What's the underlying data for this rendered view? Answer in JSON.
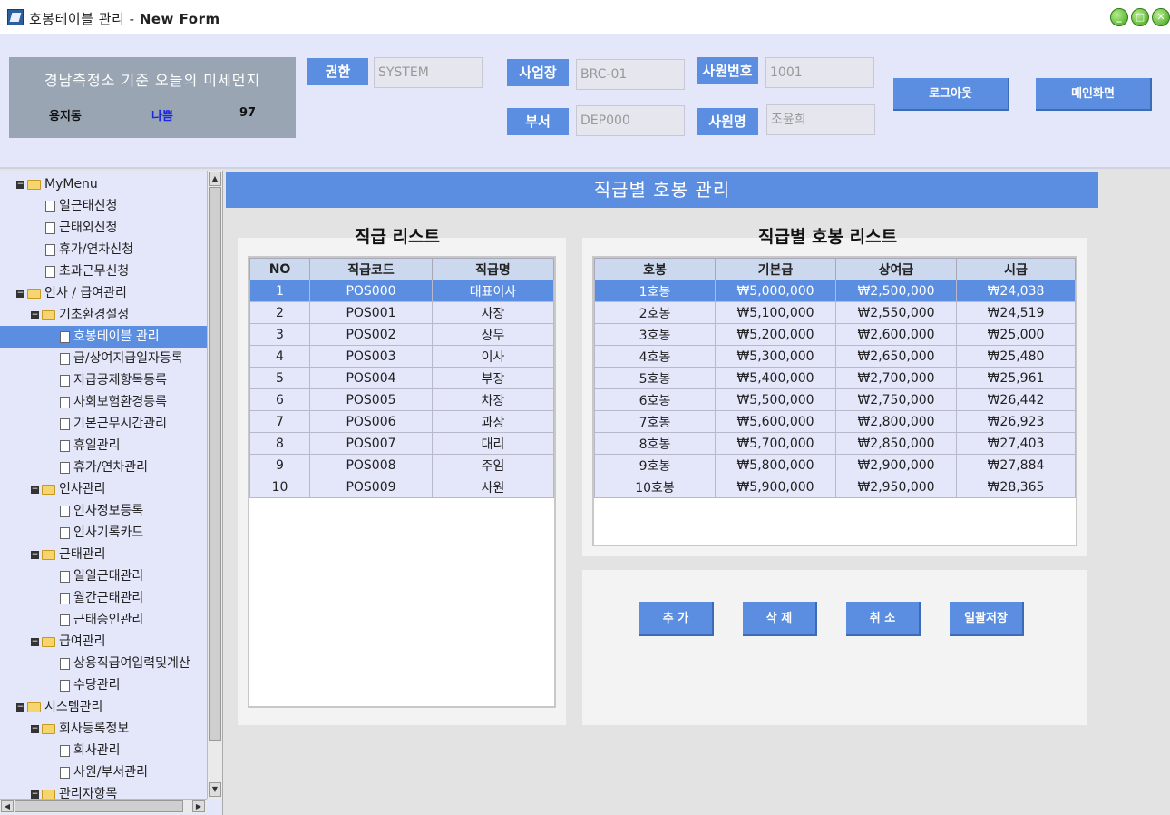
{
  "window": {
    "title_prefix": "호봉테이블 관리 - ",
    "title_bold": "New Form",
    "buttons": [
      "_",
      "□",
      "✕"
    ]
  },
  "dust": {
    "title": "경남측정소 기준 오늘의 미세먼지",
    "location": "용지동",
    "status": "나쁨",
    "value": "97"
  },
  "header": {
    "auth_label": "권한",
    "auth_value": "SYSTEM",
    "site_label": "사업장",
    "site_value": "BRC-01",
    "emp_no_label": "사원번호",
    "emp_no_value": "1001",
    "dept_label": "부서",
    "dept_value": "DEP000",
    "emp_name_label": "사원명",
    "emp_name_value": "조윤희",
    "logout_label": "로그아웃",
    "main_label": "메인화면"
  },
  "tree": [
    {
      "label": "MyMenu",
      "type": "folder"
    },
    {
      "label": "일근태신청",
      "type": "doc"
    },
    {
      "label": "근태외신청",
      "type": "doc"
    },
    {
      "label": "휴가/연차신청",
      "type": "doc"
    },
    {
      "label": "초과근무신청",
      "type": "doc"
    },
    {
      "label": "인사 / 급여관리",
      "type": "folder"
    },
    {
      "label": "기초환경설정",
      "type": "folder"
    },
    {
      "label": "호봉테이블 관리",
      "type": "doc",
      "selected": true
    },
    {
      "label": "급/상여지급일자등록",
      "type": "doc"
    },
    {
      "label": "지급공제항목등록",
      "type": "doc"
    },
    {
      "label": "사회보험환경등록",
      "type": "doc"
    },
    {
      "label": "기본근무시간관리",
      "type": "doc"
    },
    {
      "label": "휴일관리",
      "type": "doc"
    },
    {
      "label": "휴가/연차관리",
      "type": "doc"
    },
    {
      "label": "인사관리",
      "type": "folder"
    },
    {
      "label": "인사정보등록",
      "type": "doc"
    },
    {
      "label": "인사기록카드",
      "type": "doc"
    },
    {
      "label": "근태관리",
      "type": "folder"
    },
    {
      "label": "일일근태관리",
      "type": "doc"
    },
    {
      "label": "월간근태관리",
      "type": "doc"
    },
    {
      "label": "근태승인관리",
      "type": "doc"
    },
    {
      "label": "급여관리",
      "type": "folder"
    },
    {
      "label": "상용직급여입력및계산",
      "type": "doc"
    },
    {
      "label": "수당관리",
      "type": "doc"
    },
    {
      "label": "시스템관리",
      "type": "folder"
    },
    {
      "label": "회사등록정보",
      "type": "folder"
    },
    {
      "label": "회사관리",
      "type": "doc"
    },
    {
      "label": "사원/부서관리",
      "type": "doc"
    },
    {
      "label": "관리자항목",
      "type": "folder"
    }
  ],
  "main": {
    "banner": "직급별 호봉 관리",
    "left_title": "직급 리스트",
    "right_title": "직급별 호봉 리스트",
    "left_headers": [
      "NO",
      "직급코드",
      "직급명"
    ],
    "left_rows": [
      [
        "1",
        "POS000",
        "대표이사"
      ],
      [
        "2",
        "POS001",
        "사장"
      ],
      [
        "3",
        "POS002",
        "상무"
      ],
      [
        "4",
        "POS003",
        "이사"
      ],
      [
        "5",
        "POS004",
        "부장"
      ],
      [
        "6",
        "POS005",
        "차장"
      ],
      [
        "7",
        "POS006",
        "과장"
      ],
      [
        "8",
        "POS007",
        "대리"
      ],
      [
        "9",
        "POS008",
        "주임"
      ],
      [
        "10",
        "POS009",
        "사원"
      ]
    ],
    "right_headers": [
      "호봉",
      "기본급",
      "상여급",
      "시급"
    ],
    "right_rows": [
      [
        "1호봉",
        "₩5,000,000",
        "₩2,500,000",
        "₩24,038"
      ],
      [
        "2호봉",
        "₩5,100,000",
        "₩2,550,000",
        "₩24,519"
      ],
      [
        "3호봉",
        "₩5,200,000",
        "₩2,600,000",
        "₩25,000"
      ],
      [
        "4호봉",
        "₩5,300,000",
        "₩2,650,000",
        "₩25,480"
      ],
      [
        "5호봉",
        "₩5,400,000",
        "₩2,700,000",
        "₩25,961"
      ],
      [
        "6호봉",
        "₩5,500,000",
        "₩2,750,000",
        "₩26,442"
      ],
      [
        "7호봉",
        "₩5,600,000",
        "₩2,800,000",
        "₩26,923"
      ],
      [
        "8호봉",
        "₩5,700,000",
        "₩2,850,000",
        "₩27,403"
      ],
      [
        "9호봉",
        "₩5,800,000",
        "₩2,900,000",
        "₩27,884"
      ],
      [
        "10호봉",
        "₩5,900,000",
        "₩2,950,000",
        "₩28,365"
      ]
    ],
    "add_label": "추 가",
    "delete_label": "삭 제",
    "cancel_label": "취 소",
    "save_all_label": "일괄저장"
  },
  "colors": {
    "accent": "#5b8ee0",
    "header_bg": "#e4e6fa",
    "dust_bg": "#9aa5b4",
    "status_bad": "#1a27e6"
  }
}
